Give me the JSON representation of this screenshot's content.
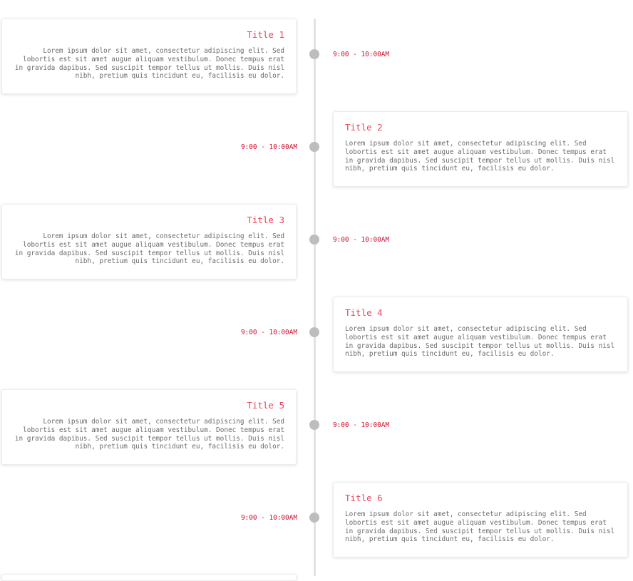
{
  "timeline": {
    "events": [
      {
        "title": "Title 1",
        "text": "Lorem ipsum dolor sit amet, consectetur adipiscing elit. Sed lobortis est sit amet augue aliquam vestibulum. Donec tempus erat in gravida dapibus. Sed suscipit tempor tellus ut mollis. Duis nisl nibh, pretium quis tincidunt eu, facilisis eu dolor.",
        "time": "9:00 - 10:00AM"
      },
      {
        "title": "Title 2",
        "text": "Lorem ipsum dolor sit amet, consectetur adipiscing elit. Sed lobortis est sit amet augue aliquam vestibulum. Donec tempus erat in gravida dapibus. Sed suscipit tempor tellus ut mollis. Duis nisl nibh, pretium quis tincidunt eu, facilisis eu dolor.",
        "time": "9:00 - 10:00AM"
      },
      {
        "title": "Title 3",
        "text": "Lorem ipsum dolor sit amet, consectetur adipiscing elit. Sed lobortis est sit amet augue aliquam vestibulum. Donec tempus erat in gravida dapibus. Sed suscipit tempor tellus ut mollis. Duis nisl nibh, pretium quis tincidunt eu, facilisis eu dolor.",
        "time": "9:00 - 10:00AM"
      },
      {
        "title": "Title 4",
        "text": "Lorem ipsum dolor sit amet, consectetur adipiscing elit. Sed lobortis est sit amet augue aliquam vestibulum. Donec tempus erat in gravida dapibus. Sed suscipit tempor tellus ut mollis. Duis nisl nibh, pretium quis tincidunt eu, facilisis eu dolor.",
        "time": "9:00 - 10:00AM"
      },
      {
        "title": "Title 5",
        "text": "Lorem ipsum dolor sit amet, consectetur adipiscing elit. Sed lobortis est sit amet augue aliquam vestibulum. Donec tempus erat in gravida dapibus. Sed suscipit tempor tellus ut mollis. Duis nisl nibh, pretium quis tincidunt eu, facilisis eu dolor.",
        "time": "9:00 - 10:00AM"
      },
      {
        "title": "Title 6",
        "text": "Lorem ipsum dolor sit amet, consectetur adipiscing elit. Sed lobortis est sit amet augue aliquam vestibulum. Donec tempus erat in gravida dapibus. Sed suscipit tempor tellus ut mollis. Duis nisl nibh, pretium quis tincidunt eu, facilisis eu dolor.",
        "time": "9:00 - 10:00AM"
      }
    ]
  },
  "colors": {
    "title": "#e8475f",
    "time": "#d1102e",
    "body_text": "#6b6b6b",
    "axis": "#e2e2e2",
    "dot": "#bdbdbd"
  }
}
